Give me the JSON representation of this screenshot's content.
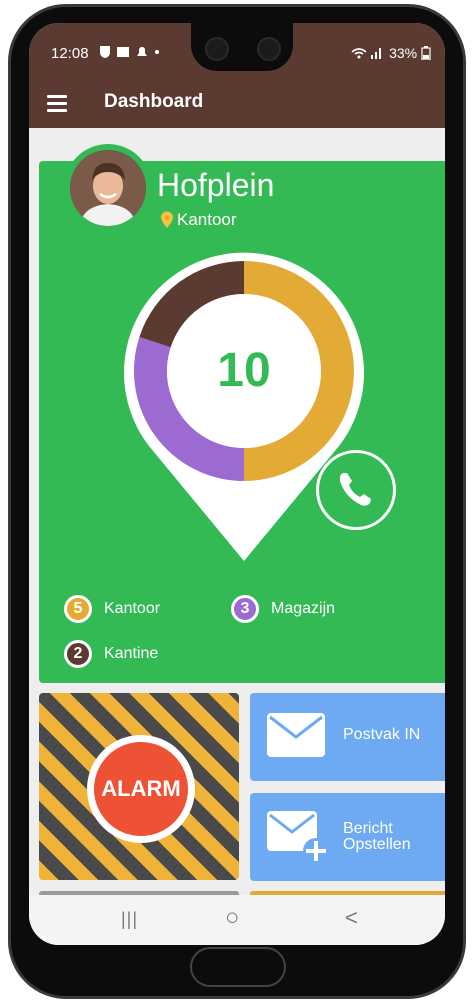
{
  "statusbar": {
    "time": "12:08",
    "left_icons": [
      "shield-icon",
      "image-icon",
      "bell-icon",
      "dot-icon"
    ],
    "battery": "33%"
  },
  "appbar": {
    "title": "Dashboard"
  },
  "location": {
    "name": "Hofplein",
    "subtitle": "Kantoor"
  },
  "donut": {
    "total": "10",
    "segments": [
      {
        "name": "Kantoor",
        "value": 5,
        "color": "#e3ab35"
      },
      {
        "name": "Magazijn",
        "value": 3,
        "color": "#9c6bd2"
      },
      {
        "name": "Kantine",
        "value": 2,
        "color": "#5b3a32"
      }
    ]
  },
  "legend": [
    {
      "count": "5",
      "label": "Kantoor",
      "color": "#e3ab35"
    },
    {
      "count": "3",
      "label": "Magazijn",
      "color": "#9c6bd2"
    },
    {
      "count": "2",
      "label": "Kantine",
      "color": "#5b3a32"
    }
  ],
  "tiles": {
    "alarm_label": "ALARM",
    "inbox_label": "Postvak IN",
    "compose_line1": "Bericht",
    "compose_line2": "Opstellen"
  },
  "colors": {
    "brand_brown": "#5b3a32",
    "green": "#34ba55",
    "mail_blue": "#6eaaf1",
    "alarm_red": "#ee5235"
  },
  "navbar": {
    "recent": "|||",
    "home": "○",
    "back": "<"
  }
}
